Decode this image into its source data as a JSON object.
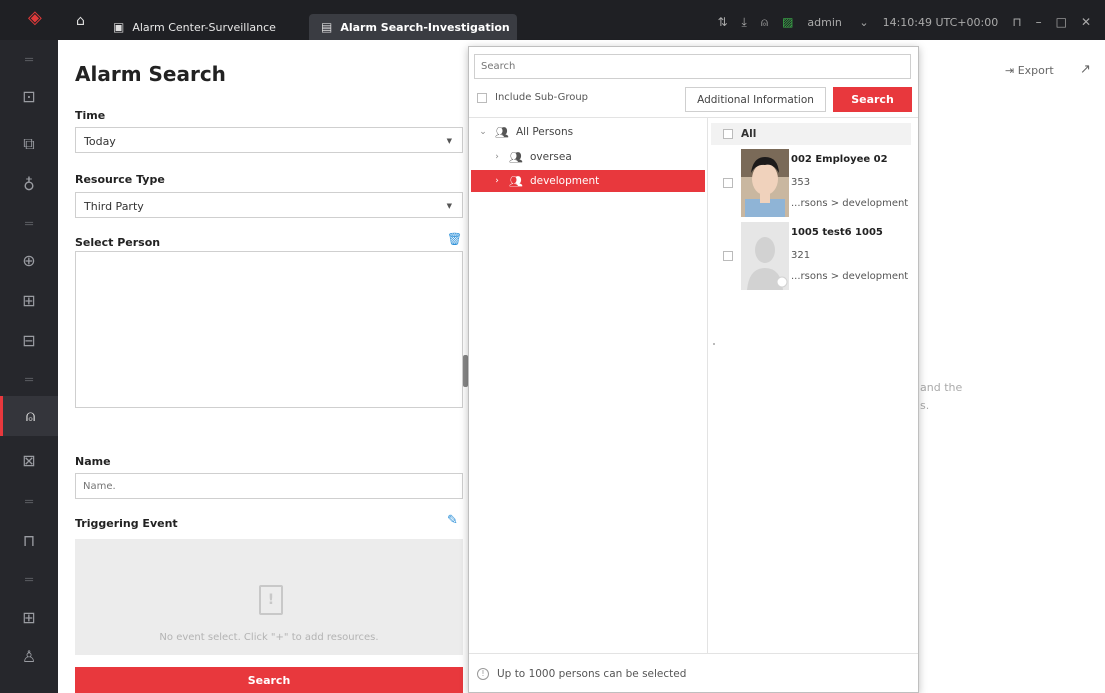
{
  "titlebar": {
    "tab1_label": "Alarm Center-Surveillance",
    "tab2_label": "Alarm Search-Investigation",
    "user": "admin",
    "time": "14:10:49 UTC+00:00"
  },
  "left": {
    "title": "Alarm Search",
    "time_label": "Time",
    "time_value": "Today",
    "resource_label": "Resource Type",
    "resource_value": "Third Party",
    "person_label": "Select Person",
    "name_label": "Name",
    "name_placeholder": "Name.",
    "event_label": "Triggering Event",
    "event_empty": "No event select. Click \"+\" to add resources.",
    "search_button": "Search"
  },
  "right": {
    "export_label": "Export",
    "hint_line1": "and the",
    "hint_line2": "s."
  },
  "popup": {
    "search_placeholder": "Search",
    "include_sub_group": "Include Sub-Group",
    "additional_info": "Additional Information",
    "search_button": "Search",
    "tree": [
      {
        "label": "All Persons"
      },
      {
        "label": "oversea"
      },
      {
        "label": "development"
      }
    ],
    "all_label": "All",
    "persons": [
      {
        "name": "002 Employee 02",
        "id": "353",
        "group": "...rsons > development"
      },
      {
        "name": "1005 test6 1005",
        "id": "321",
        "group": "...rsons > development"
      }
    ],
    "footer": "Up to 1000 persons can be selected"
  },
  "colors": {
    "accent": "#e8383d",
    "sidebar": "#26272c",
    "titlebar": "#1f2024"
  }
}
